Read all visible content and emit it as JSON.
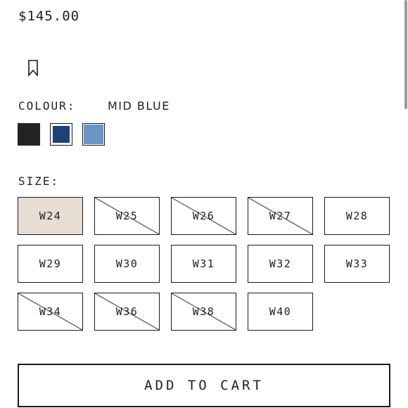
{
  "product": {
    "price": "$145.00"
  },
  "wishlist": {
    "icon": "bookmark-icon"
  },
  "colour": {
    "label": "COLOUR:",
    "selected": "MID BLUE",
    "swatches": [
      {
        "name": "black",
        "color": "#232323",
        "selected": false
      },
      {
        "name": "mid-blue",
        "color": "#1f4276",
        "selected": true
      },
      {
        "name": "light-blue",
        "color": "#6d95c7",
        "selected": false
      }
    ]
  },
  "size": {
    "label": "SIZE:",
    "options": [
      {
        "label": "W24",
        "available": true,
        "selected": true
      },
      {
        "label": "W25",
        "available": false,
        "selected": false
      },
      {
        "label": "W26",
        "available": false,
        "selected": false
      },
      {
        "label": "W27",
        "available": false,
        "selected": false
      },
      {
        "label": "W28",
        "available": true,
        "selected": false
      },
      {
        "label": "W29",
        "available": true,
        "selected": false
      },
      {
        "label": "W30",
        "available": true,
        "selected": false
      },
      {
        "label": "W31",
        "available": true,
        "selected": false
      },
      {
        "label": "W32",
        "available": true,
        "selected": false
      },
      {
        "label": "W33",
        "available": true,
        "selected": false
      },
      {
        "label": "W34",
        "available": false,
        "selected": false
      },
      {
        "label": "W36",
        "available": false,
        "selected": false
      },
      {
        "label": "W38",
        "available": false,
        "selected": false
      },
      {
        "label": "W40",
        "available": true,
        "selected": false
      }
    ]
  },
  "cart": {
    "button_label": "ADD TO CART"
  },
  "colors": {
    "selected_size_bg": "#e8ddd3",
    "border": "#1a1a1a",
    "text": "#1f1f1f"
  }
}
